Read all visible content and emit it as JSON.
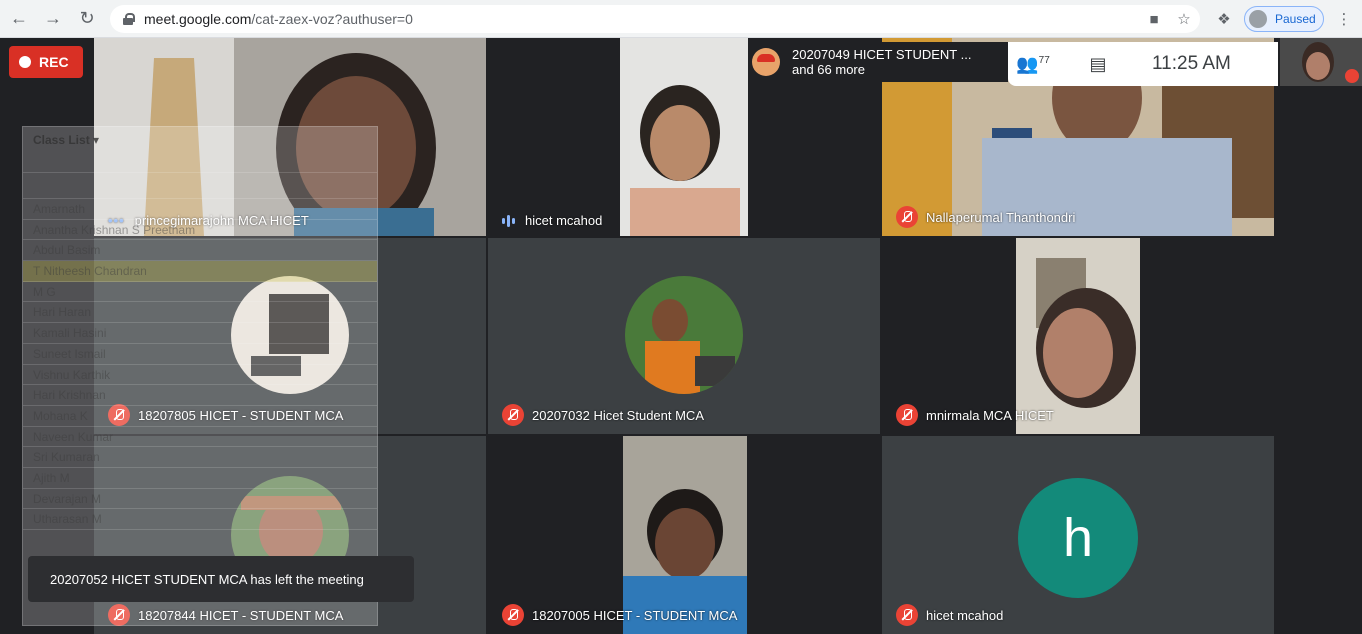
{
  "browser": {
    "url_host": "meet.google.com",
    "url_path": "/cat-zaex-voz?authuser=0",
    "profile_status": "Paused"
  },
  "meet": {
    "rec_label": "REC",
    "presenter_line1": "20207049 HICET STUDENT ...",
    "presenter_line2": "and 66 more",
    "people_count": "77",
    "time": "11:25 AM"
  },
  "participants": [
    {
      "name": "princegimarajohn MCA HICET"
    },
    {
      "name": "hicet mcahod"
    },
    {
      "name": "Nallaperumal Thanthondri"
    },
    {
      "name": "18207805 HICET - STUDENT MCA"
    },
    {
      "name": "20207032 Hicet Student MCA"
    },
    {
      "name": "mnirmala MCA HICET"
    },
    {
      "name": "18207844 HICET - STUDENT MCA"
    },
    {
      "name": "18207005 HICET - STUDENT MCA"
    },
    {
      "name": "hicet mcahod",
      "avatar_letter": "h"
    }
  ],
  "class_list": {
    "title": "Class List",
    "rows": [
      "Amarnath",
      "Anantha Krishnan S Preetham",
      "Abdul Basim",
      "T Nitheesh Chandran",
      "M G",
      "Hari Haran",
      "Kamali Hasini",
      "Suneet Ismail",
      "Vishnu Karthik",
      "Hari Krishnan",
      "Mohana K",
      "Naveen Kumar",
      "Sri Kumaran",
      "Ajith M",
      "Devarajan M",
      "Utharasan M"
    ]
  },
  "toast": "20207052 HICET STUDENT MCA has left the meeting",
  "colors": {
    "rec": "#d93025",
    "mic_off": "#ea4335",
    "avatar_h": "#138a7a"
  }
}
